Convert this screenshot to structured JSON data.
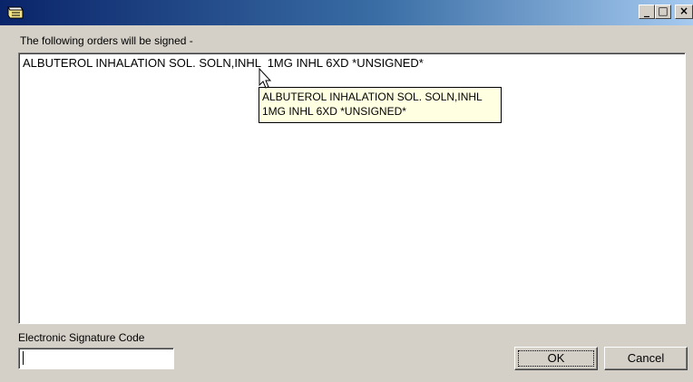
{
  "window": {
    "icons": {
      "app": "notepad-icon",
      "minimize": "minimize-icon",
      "maximize": "maximize-icon",
      "close": "close-icon"
    },
    "controls": {
      "minimize": "_",
      "maximize": "□",
      "close": "×"
    }
  },
  "dialog": {
    "heading": "The following orders will be signed -",
    "orders": [
      "ALBUTEROL INHALATION SOL. SOLN,INHL  1MG INHL 6XD *UNSIGNED*"
    ],
    "tooltip": {
      "line1": "ALBUTEROL INHALATION SOL. SOLN,INHL",
      "line2": "1MG INHL 6XD *UNSIGNED*"
    },
    "signature": {
      "label": "Electronic Signature Code",
      "value": ""
    },
    "buttons": {
      "ok": "OK",
      "cancel": "Cancel"
    }
  },
  "colors": {
    "titlebar_start": "#0a246a",
    "titlebar_end": "#a6caf0",
    "dialog_bg": "#d4d0c8",
    "tooltip_bg": "#ffffe1"
  }
}
